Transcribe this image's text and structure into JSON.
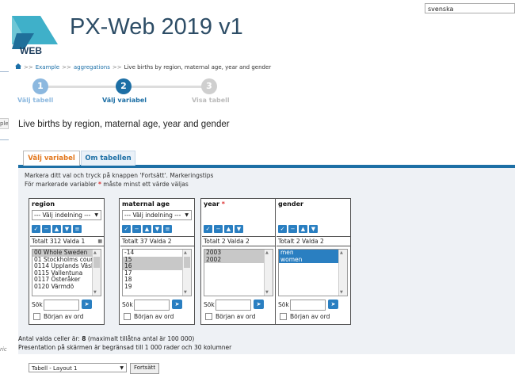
{
  "header": {
    "language": "svenska",
    "app_title": "PX-Web 2019 v1",
    "logo_text": "WEB"
  },
  "breadcrumb": {
    "home_icon": "home-icon",
    "items": [
      "Example",
      "aggregations",
      "Live births by region, maternal age, year and gender"
    ],
    "separator": ">>"
  },
  "steps": [
    {
      "number": "1",
      "label": "Välj tabell",
      "state": "done"
    },
    {
      "number": "2",
      "label": "Välj variabel",
      "state": "active"
    },
    {
      "number": "3",
      "label": "Visa tabell",
      "state": "pending"
    }
  ],
  "left_strip": {
    "field_fragment": "ple",
    "text_fragment": "ric"
  },
  "main": {
    "heading": "Live births by region, maternal age, year and gender"
  },
  "tabs": [
    {
      "label": "Välj variabel",
      "active": true
    },
    {
      "label": "Om tabellen",
      "active": false
    }
  ],
  "instructions": {
    "line1": "Markera ditt val och tryck på knappen 'Fortsätt'. Markeringstips",
    "line2_before": "För markerade variabler",
    "line2_star": "*",
    "line2_after": "måste minst ett värde väljas"
  },
  "variables": [
    {
      "title": "region",
      "required": false,
      "classification": "--- Välj indelning ---",
      "total": "Totalt 312 Valda 1",
      "show_xl": true,
      "values": [
        "00 Whole Sweden",
        "01 Stockholms county",
        "0114 Upplands Väsby",
        "0115 Vallentuna",
        "0117 Österåker",
        "0120 Värmdö"
      ],
      "selected": [
        0
      ],
      "sel_style": "grey",
      "search_label": "Sök",
      "checkbox_label": "Början av ord"
    },
    {
      "title": "maternal age",
      "required": false,
      "classification": "--- Välj indelning ---",
      "total": "Totalt 37 Valda 2",
      "show_xl": false,
      "values": [
        "-14",
        "15",
        "16",
        "17",
        "18",
        "19"
      ],
      "selected": [
        1,
        2
      ],
      "sel_style": "grey",
      "search_label": "Sök",
      "checkbox_label": "Början av ord"
    },
    {
      "title": "year",
      "required": true,
      "classification": "",
      "total": "Totalt 2 Valda 2",
      "show_xl": false,
      "values": [
        "2003",
        "2002"
      ],
      "selected": [
        0,
        1
      ],
      "sel_style": "grey",
      "search_label": "Sök",
      "checkbox_label": "Början av ord"
    },
    {
      "title": "gender",
      "required": false,
      "classification": "",
      "total": "Totalt 2 Valda 2",
      "show_xl": false,
      "values": [
        "men",
        "women"
      ],
      "selected": [
        0,
        1
      ],
      "sel_style": "blue",
      "search_label": "Sök",
      "checkbox_label": "Början av ord"
    }
  ],
  "summary": {
    "cells_label": "Antal valda celler är:",
    "cells_count": "8",
    "cells_max": "(maximalt tillåtna antal är 100 000)",
    "limit_text": "Presentation på skärmen är begränsad till 1 000 rader och 30 kolumner"
  },
  "footer": {
    "layout_select": "Tabell - Layout 1",
    "continue_button": "Fortsätt"
  },
  "colors": {
    "accent_blue": "#1d6fa5",
    "active_tab_text": "#e2761b",
    "step_done": "#8cb8df",
    "step_active": "#1d6fa5",
    "step_pending": "#cfcfcf"
  }
}
